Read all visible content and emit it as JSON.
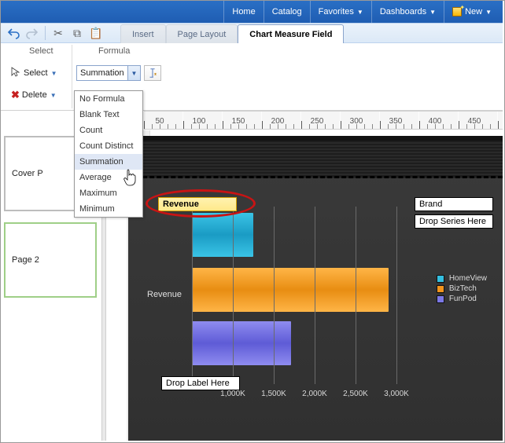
{
  "topnav": {
    "home": "Home",
    "catalog": "Catalog",
    "fav": "Favorites",
    "dash": "Dashboards",
    "new": "New"
  },
  "ribbon": {
    "tabs": {
      "insert": "Insert",
      "layout": "Page Layout",
      "chart": "Chart Measure Field"
    },
    "groups": {
      "select": "Select",
      "formula": "Formula"
    },
    "buttons": {
      "select": "Select",
      "delete": "Delete"
    },
    "formula_value": "Summation"
  },
  "formula_options": [
    "No Formula",
    "Blank Text",
    "Count",
    "Count Distinct",
    "Summation",
    "Average",
    "Maximum",
    "Minimum"
  ],
  "ruler": {
    "ticks": [
      50,
      100,
      150,
      200,
      250,
      300,
      350,
      400,
      450
    ]
  },
  "pages": {
    "cover": "Cover P",
    "p2": "Page 2"
  },
  "chart": {
    "ylabel": "Revenue",
    "zones": {
      "measure": "Revenue",
      "brand": "Brand",
      "series": "Drop Series Here",
      "label": "Drop Label Here"
    },
    "legend": [
      {
        "name": "HomeView",
        "color": "#34bfe1"
      },
      {
        "name": "BizTech",
        "color": "#f2941c"
      },
      {
        "name": "FunPod",
        "color": "#7b78e6"
      }
    ],
    "xticks": [
      "1,000K",
      "1,500K",
      "2,000K",
      "2,500K",
      "3,000K"
    ]
  },
  "chart_data": {
    "type": "bar",
    "orientation": "horizontal",
    "title": "",
    "xlabel": "",
    "ylabel": "Revenue",
    "xlim": [
      0,
      3000
    ],
    "x_unit": "K",
    "categories": [
      "HomeView",
      "BizTech",
      "FunPod"
    ],
    "series": [
      {
        "name": "Revenue",
        "values": [
          750,
          2400,
          1200
        ]
      }
    ],
    "legend_position": "right"
  }
}
